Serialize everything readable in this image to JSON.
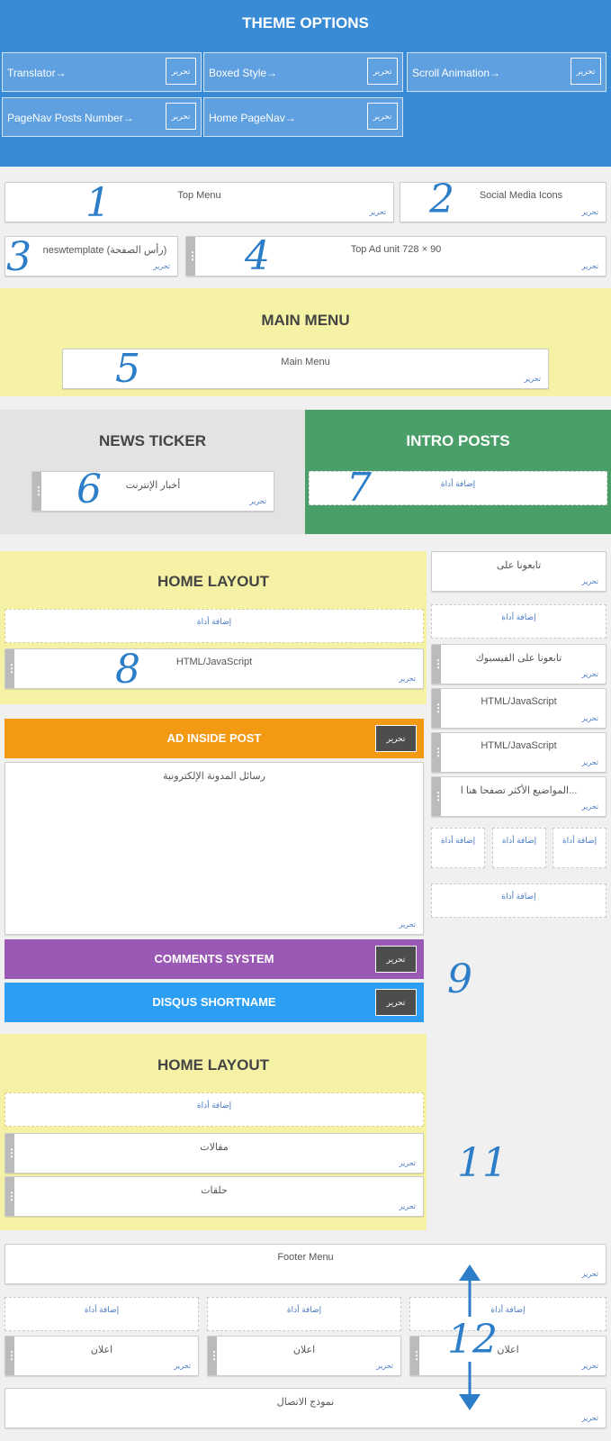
{
  "theme": {
    "title": "THEME OPTIONS",
    "options": [
      {
        "label": "Translator→",
        "button": "تحرير"
      },
      {
        "label": "Boxed Style→",
        "button": "تحرير"
      },
      {
        "label": "Scroll Animation→",
        "button": "تحرير"
      },
      {
        "label": "PageNav Posts Number→",
        "button": "تحرير"
      },
      {
        "label": "Home PageNav→",
        "button": "تحرير"
      }
    ]
  },
  "edit_label": "تحرير",
  "add_label": "إضافة أداة",
  "header_row": {
    "top_menu": "Top Menu",
    "social_icons": "Social Media Icons",
    "header_title": "neswtemplate (رأس الصفحة)",
    "top_ad": "Top Ad unit 728 × 90"
  },
  "main_menu": {
    "title": "MAIN MENU",
    "widget": "Main Menu"
  },
  "news_ticker": {
    "title": "NEWS TICKER",
    "widget": "أخبار الإنترنت"
  },
  "intro_posts": {
    "title": "INTRO POSTS"
  },
  "home_layout_1": {
    "title": "HOME LAYOUT",
    "widget": "HTML/JavaScript"
  },
  "ad_inside_post": {
    "title": "AD INSIDE POST",
    "button": "تحرير",
    "widget": "رسائل المدونة الإلكترونية"
  },
  "comments_system": {
    "title": "COMMENTS SYSTEM",
    "button": "تحرير"
  },
  "disqus": {
    "title": "DISQUS SHORTNAME",
    "button": "تحرير"
  },
  "home_layout_2": {
    "title": "HOME LAYOUT",
    "widgets": [
      "مقالات",
      "حلقات"
    ]
  },
  "sidebar": {
    "follow": "تابعونا على",
    "facebook": "تابعونا على الفيسبوك",
    "html1": "HTML/JavaScript",
    "html2": "HTML/JavaScript",
    "popular": "المواضيع الأكثر تصفحا هنا ا..."
  },
  "footer": {
    "menu": "Footer Menu",
    "ads": [
      "اعلان",
      "اعلان",
      "اعلان"
    ],
    "contact": "نموذج الاتصال"
  },
  "annotations": [
    "1",
    "2",
    "3",
    "4",
    "5",
    "6",
    "7",
    "8",
    "9",
    "11",
    "12"
  ],
  "colors": {
    "theme_blue": "#3a8bd5",
    "option_blue": "#5ea0e0",
    "yellow": "#f5f2a6",
    "grey_section": "#e3e3e3",
    "green": "#4a9e68",
    "orange": "#f39a12",
    "purple": "#9b59b6",
    "light_blue": "#2c9ff5",
    "annotation": "#2d7ec8"
  }
}
